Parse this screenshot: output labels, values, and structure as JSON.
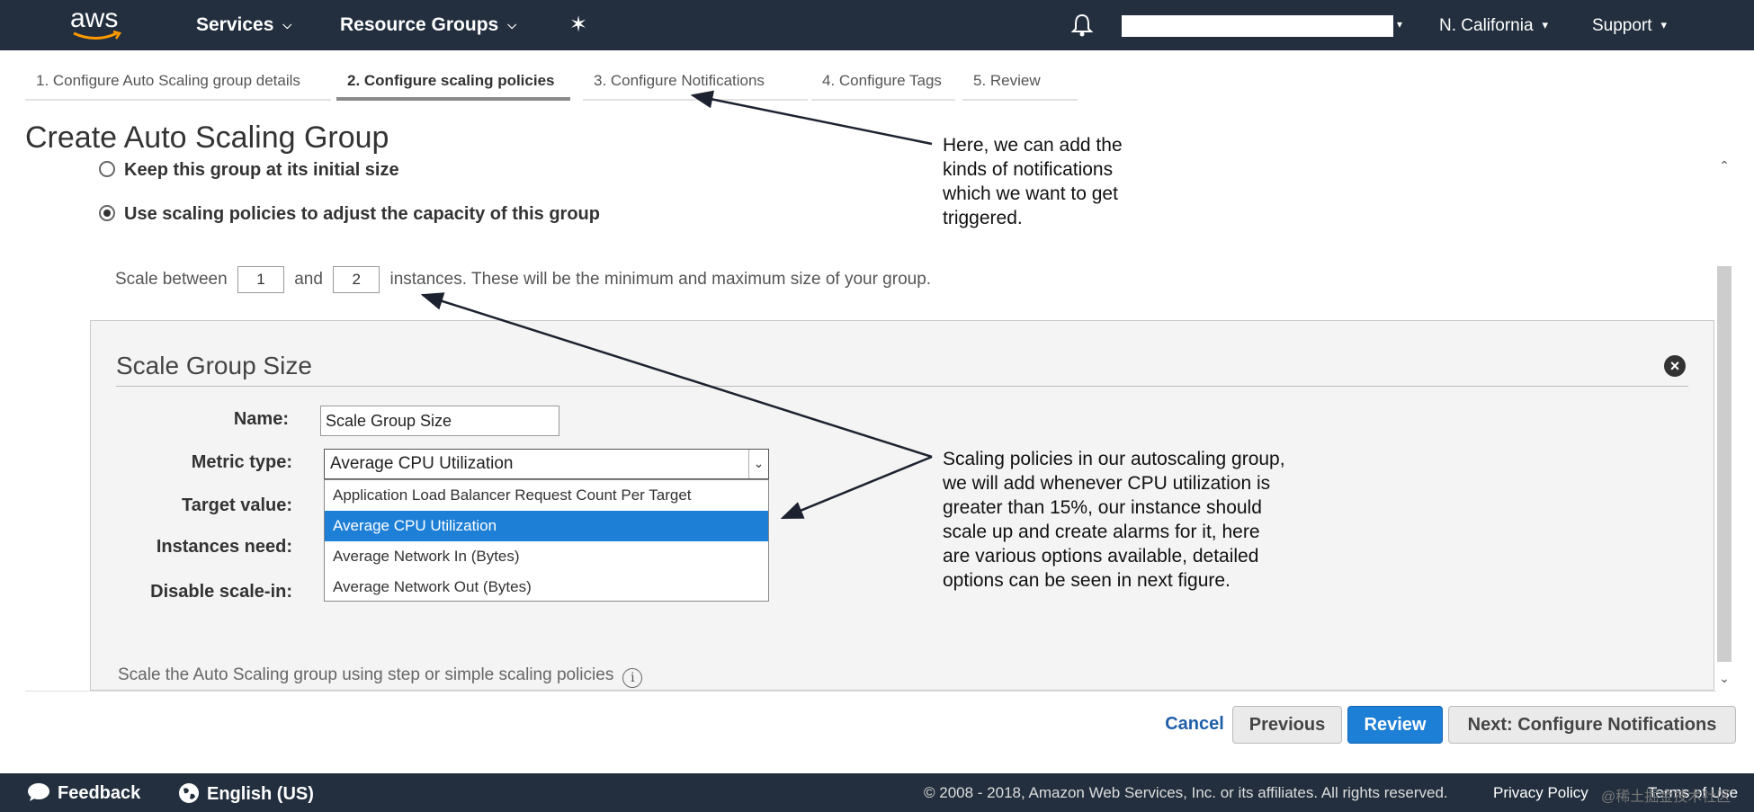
{
  "nav": {
    "logo": "aws",
    "services": "Services",
    "resource_groups": "Resource Groups",
    "region": "N. California",
    "support": "Support",
    "pin_icon": "pin-icon",
    "bell_icon": "bell-icon"
  },
  "tabs": [
    {
      "label": "1. Configure Auto Scaling group details"
    },
    {
      "label": "2. Configure scaling policies"
    },
    {
      "label": "3. Configure Notifications"
    },
    {
      "label": "4. Configure Tags"
    },
    {
      "label": "5. Review"
    }
  ],
  "page_title": "Create Auto Scaling Group",
  "options": {
    "keep_size": "Keep this group at its initial size",
    "use_policies": "Use scaling policies to adjust the capacity of this group"
  },
  "scale": {
    "prefix": "Scale between",
    "min": "1",
    "and": "and",
    "max": "2",
    "suffix": "instances. These will be the minimum and maximum size of your group."
  },
  "panel": {
    "title": "Scale Group Size",
    "name_label": "Name:",
    "name_value": "Scale Group Size",
    "metric_label": "Metric type:",
    "metric_value": "Average CPU Utilization",
    "target_label": "Target value:",
    "instances_label": "Instances need:",
    "disable_label": "Disable scale-in:",
    "dropdown_options": [
      "Application Load Balancer Request Count Per Target",
      "Average CPU Utilization",
      "Average Network In (Bytes)",
      "Average Network Out (Bytes)"
    ],
    "footer_text": "Scale the Auto Scaling group using step or simple scaling policies"
  },
  "annotations": {
    "note1": [
      "Here, we can add the",
      "kinds of notifications",
      "which we want to get",
      "triggered."
    ],
    "note2": [
      "Scaling policies in our autoscaling group,",
      "we will add whenever CPU utilization is",
      "greater than 15%, our instance should",
      "scale up and create alarms for it, here",
      "are various options available, detailed",
      "options can be seen in next figure."
    ]
  },
  "buttons": {
    "cancel": "Cancel",
    "previous": "Previous",
    "review": "Review",
    "next": "Next: Configure Notifications"
  },
  "footer": {
    "feedback": "Feedback",
    "language": "English (US)",
    "copyright": "© 2008 - 2018, Amazon Web Services, Inc. or its affiliates. All rights reserved.",
    "privacy": "Privacy Policy",
    "terms": "Terms of Use",
    "watermark": "@稀土掘金技术社区"
  },
  "colors": {
    "nav_bg": "#232f3e",
    "primary_button": "#1e7fd6",
    "selected_option": "#1e7fd6"
  }
}
